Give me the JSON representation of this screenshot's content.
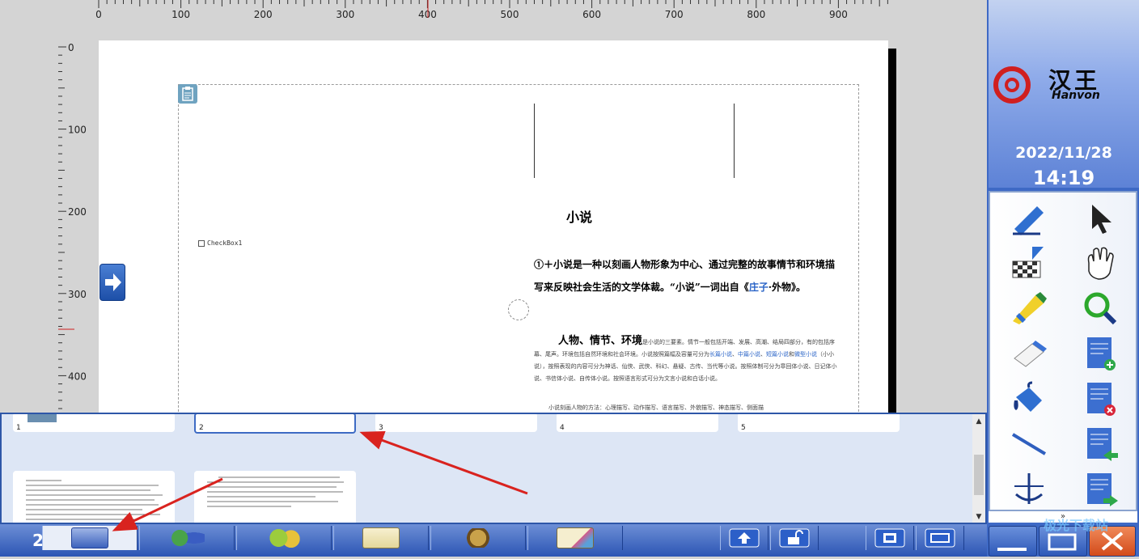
{
  "ruler": {
    "h_ticks": [
      "0",
      "100",
      "200",
      "300",
      "400",
      "500",
      "600",
      "700",
      "800",
      "900"
    ],
    "v_ticks": [
      "0",
      "100",
      "200",
      "300",
      "400"
    ]
  },
  "document": {
    "title": "小说",
    "checkbox_label": "CheckBox1",
    "para1_prefix": "①＋小说是一种以刻画人物形象为中心、通过完整的故事情节和环境描写来反映社会生活的文学体裁。“小说”一词出自《",
    "para1_link": "庄子",
    "para1_suffix": "·外物》。",
    "para2_heading": "人物、情节、环境",
    "para2_text": "是小说的三要素。情节一般包括开端、发展、高潮、结局四部分，有的包括序幕、尾声。环境包括自然环境和社会环境。小说按照篇幅及容量可分为",
    "para2_links": [
      "长篇小说",
      "中篇小说",
      "短篇小说",
      "微型小说"
    ],
    "para2_text2": "（小小说），按照表现的内容可分为神话、仙侠、武侠、科幻、悬疑、古传、当代等小说。按照体制可分为章回体小说、日记体小说、书信体小说、自传体小说。按照语言形式可分为文言小说和白话小说。",
    "para3_text": "小说刻画人物的方法：心理描写、动作描写、语言描写、外貌描写、神态描写、侧面描"
  },
  "thumbnails": [
    {
      "num": "1"
    },
    {
      "num": "2"
    },
    {
      "num": "3"
    },
    {
      "num": "4"
    },
    {
      "num": "5"
    }
  ],
  "taskbar": {
    "page_number": "2",
    "buttons": [
      "page-grid-icon",
      "database-icon",
      "settings-gears-icon",
      "notes-icon",
      "film-reel-icon",
      "edit-sheet-icon"
    ],
    "right_buttons": [
      "up-arrow-icon",
      "unlock-icon",
      "screen-capture-icon",
      "window-icon"
    ]
  },
  "sidebar": {
    "logo_cn": "汉王",
    "logo_en": "Hanvon",
    "date": "2022/11/28",
    "time": "14:19",
    "tools": [
      "pen-icon",
      "pointer-icon",
      "texture-pen-icon",
      "hand-icon",
      "highlighter-icon",
      "zoom-icon",
      "eraser-icon",
      "add-page-icon",
      "fill-bucket-icon",
      "delete-page-icon",
      "line-icon",
      "previous-page-icon",
      "compass-icon",
      "next-page-icon"
    ],
    "expand_label": "»"
  },
  "watermark": "极光下载站",
  "colors": {
    "accent": "#2e57a8",
    "link": "#2a64c7",
    "logo_red": "#d01f1f"
  }
}
